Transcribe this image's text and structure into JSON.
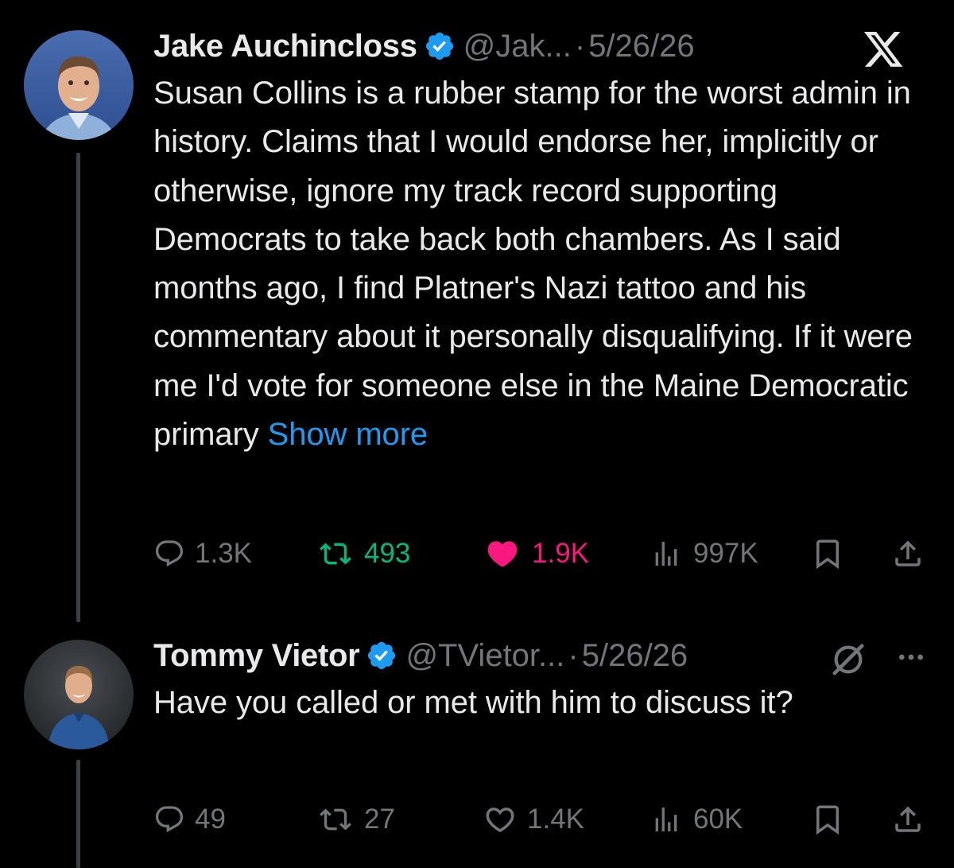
{
  "tweets": [
    {
      "author": {
        "name": "Jake Auchincloss",
        "handle": "@Jak...",
        "verified": true
      },
      "separator": "·",
      "date": "5/26/26",
      "text": "Susan Collins is a rubber stamp for the worst admin in history. Claims that I would endorse her, implicitly or otherwise, ignore my track record supporting Democrats to take back both chambers. As I said months ago, I find Platner's Nazi tattoo and his commentary about it personally disqualifying. If it were me I'd vote for someone else in the Maine Democratic primary",
      "show_more": "Show more",
      "top_right_icon": "x-logo-icon",
      "stats": {
        "replies": "1.3K",
        "reposts": "493",
        "likes": "1.9K",
        "views": "997K"
      },
      "reposted": true,
      "liked": true
    },
    {
      "author": {
        "name": "Tommy Vietor",
        "handle": "@TVietor...",
        "verified": true
      },
      "separator": "·",
      "date": "5/26/26",
      "text": "Have you called or met with him to discuss it?",
      "top_right_icons": [
        "grok-icon",
        "more-icon"
      ],
      "stats": {
        "replies": "49",
        "reposts": "27",
        "likes": "1.4K",
        "views": "60K"
      },
      "reposted": false,
      "liked": false
    }
  ],
  "colors": {
    "background": "#000000",
    "primary_text": "#e7e9ea",
    "secondary_text": "#71767b",
    "link": "#1d9bf0",
    "verified": "#1d9bf0",
    "repost_active": "#00ba7c",
    "like_active": "#f91880"
  }
}
